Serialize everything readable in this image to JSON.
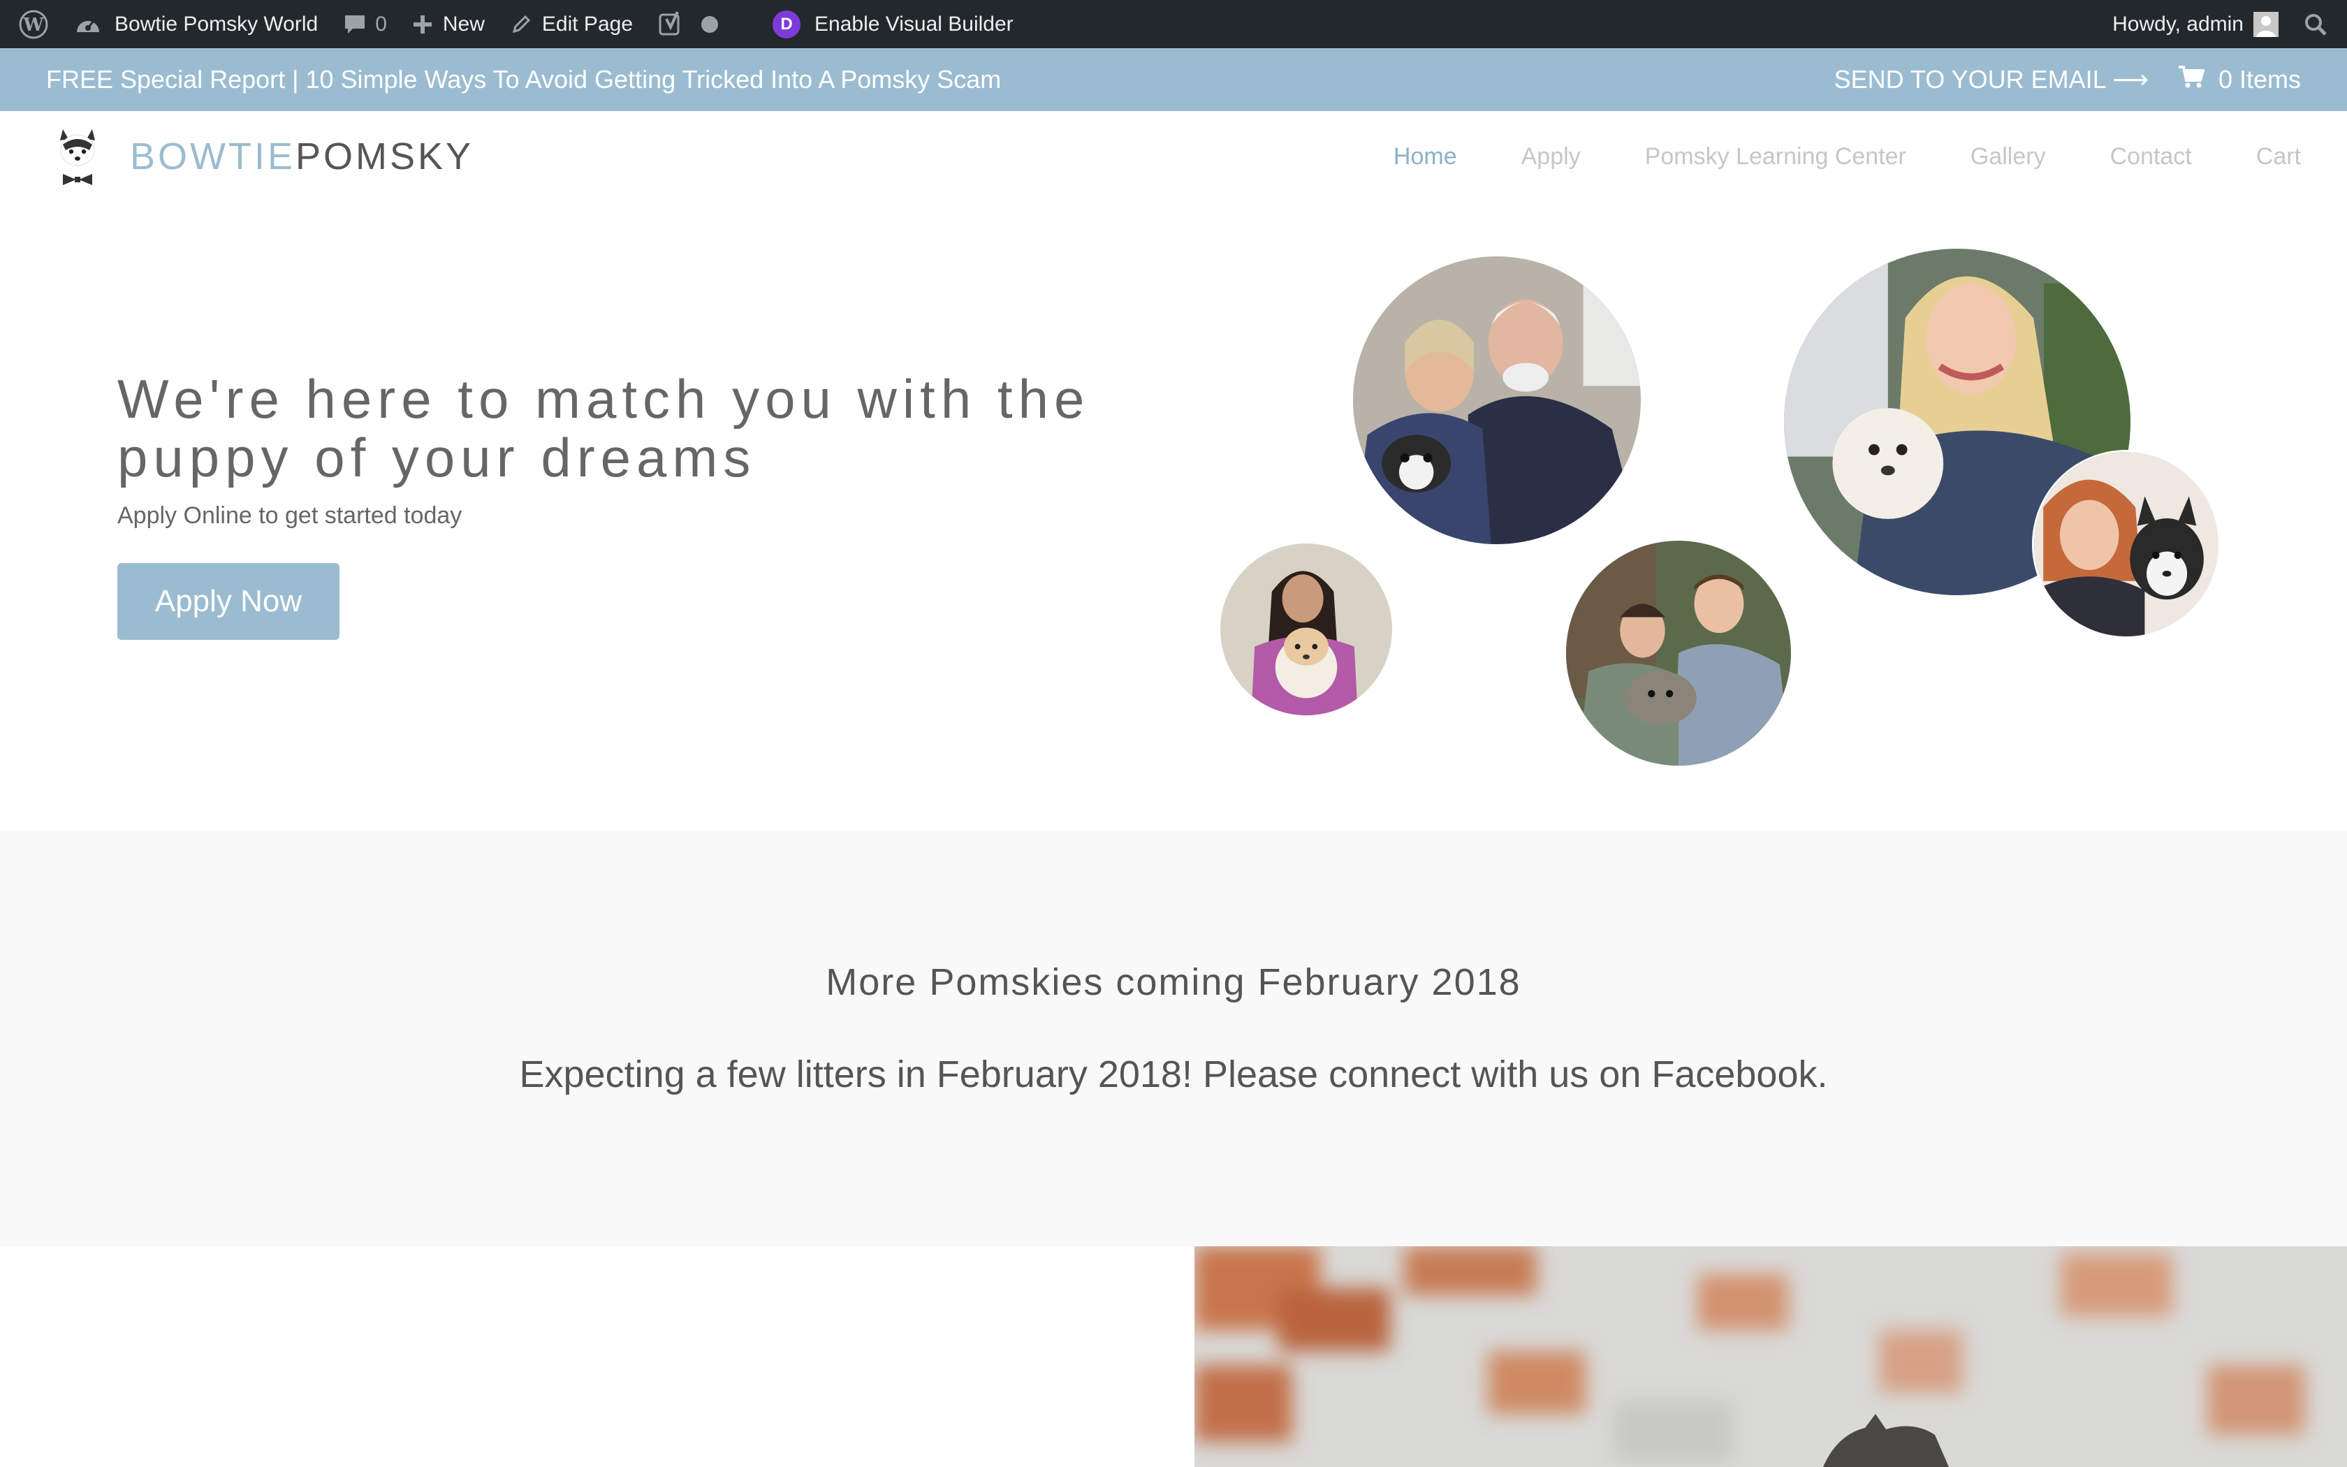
{
  "adminbar": {
    "site_name": "Bowtie Pomsky World",
    "comments_count": "0",
    "new_label": "New",
    "edit_label": "Edit Page",
    "visual_builder_label": "Enable Visual Builder",
    "divi_letter": "D",
    "greeting": "Howdy, admin",
    "icons": [
      "wordpress-icon",
      "dashboard-icon",
      "comment-icon",
      "plus-icon",
      "pencil-icon",
      "yoast-icon",
      "status-dot-icon",
      "divi-icon",
      "user-icon",
      "search-icon"
    ]
  },
  "promo": {
    "report_text": "FREE Special Report | 10 Simple Ways To Avoid Getting Tricked Into A Pomsky Scam",
    "send_text": "SEND TO YOUR EMAIL ⟶",
    "cart_text": "0 Items",
    "background": "#9bbcd0"
  },
  "header": {
    "logo_part1": "BOWTIE",
    "logo_part2": "POMSKY",
    "nav": [
      {
        "label": "Home",
        "active": true
      },
      {
        "label": "Apply",
        "active": false
      },
      {
        "label": "Pomsky Learning Center",
        "active": false
      },
      {
        "label": "Gallery",
        "active": false
      },
      {
        "label": "Contact",
        "active": false
      },
      {
        "label": "Cart",
        "active": false
      }
    ],
    "accent_color": "#8bb1c9"
  },
  "hero": {
    "title": "We're here to match you with the puppy of your dreams",
    "subtitle": "Apply Online to get started today",
    "button_label": "Apply Now"
  },
  "announce": {
    "title": "More Pomskies coming February 2018",
    "body": "Expecting a few litters in February 2018! Please connect with us on Facebook."
  }
}
